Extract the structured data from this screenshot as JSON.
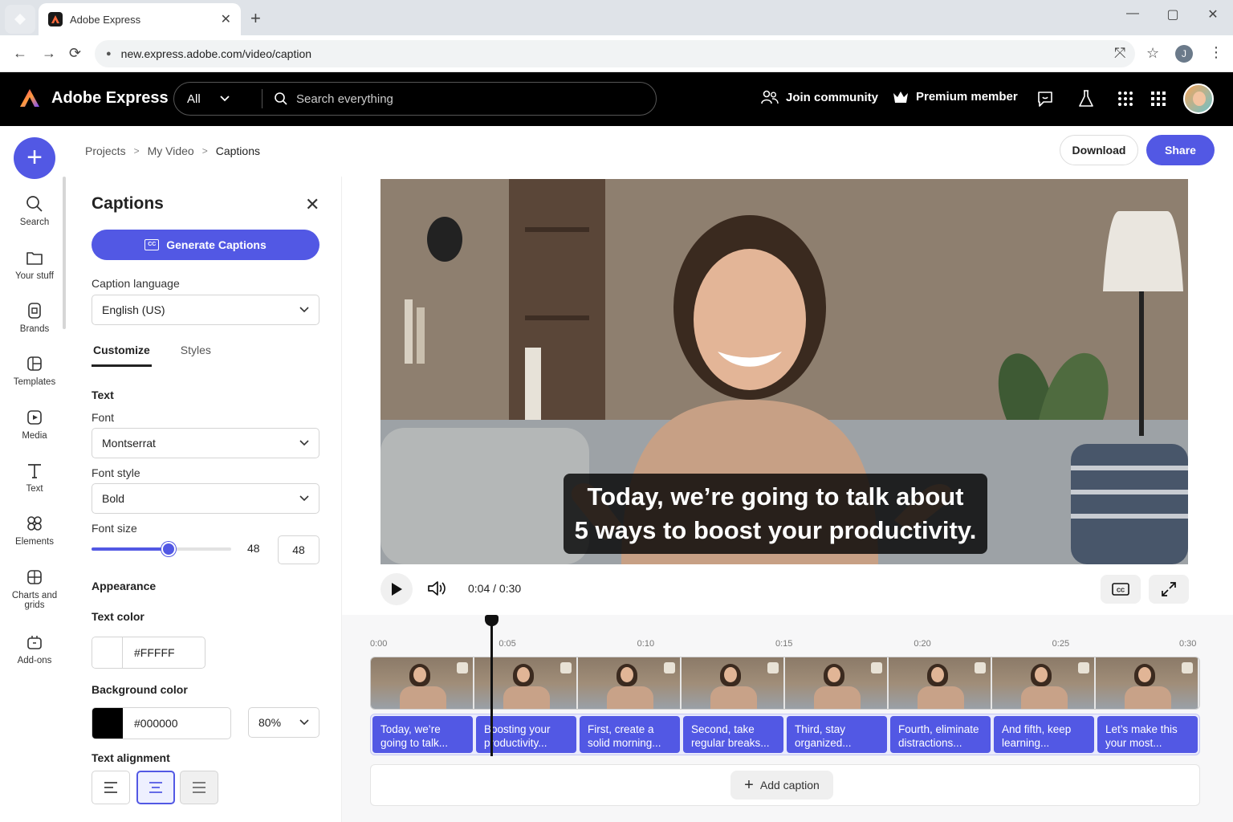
{
  "browser": {
    "tab_title": "Adobe Express",
    "url": "new.express.adobe.com/video/caption",
    "profile_initial": "J"
  },
  "header": {
    "brand": "Adobe Express",
    "search_scope": "All",
    "search_placeholder": "Search everything",
    "join_community": "Join community",
    "premium": "Premium member"
  },
  "rail": {
    "items": [
      {
        "label": "Search",
        "icon": "search-icon"
      },
      {
        "label": "Your stuff",
        "icon": "folder-icon"
      },
      {
        "label": "Brands",
        "icon": "brands-icon"
      },
      {
        "label": "Templates",
        "icon": "templates-icon"
      },
      {
        "label": "Media",
        "icon": "media-icon"
      },
      {
        "label": "Text",
        "icon": "text-icon"
      },
      {
        "label": "Elements",
        "icon": "elements-icon"
      },
      {
        "label": "Charts and grids",
        "icon": "grid-icon"
      },
      {
        "label": "Add-ons",
        "icon": "addons-icon"
      }
    ]
  },
  "breadcrumb": [
    "Projects",
    "My Video",
    "Captions"
  ],
  "actions": {
    "download": "Download",
    "share": "Share"
  },
  "panel": {
    "title": "Captions",
    "generate": "Generate Captions",
    "caption_language_label": "Caption language",
    "caption_language": "English (US)",
    "tabs": [
      "Customize",
      "Styles"
    ],
    "text_section": "Text",
    "font_label": "Font",
    "font": "Montserrat",
    "font_style_label": "Font style",
    "font_style": "Bold",
    "font_size_label": "Font size",
    "font_size": "48",
    "font_size_fraction": 0.55,
    "appearance": "Appearance",
    "text_color_label": "Text color",
    "text_color": "#FFFFF",
    "bg_color_label": "Background color",
    "bg_color": "#000000",
    "bg_opacity": "80%",
    "alignment_label": "Text alignment",
    "alignment_selected": "center"
  },
  "video": {
    "caption_line1": "Today, we’re going to talk about",
    "caption_line2": "5 ways to boost your productivity.",
    "current_time": "0:04",
    "duration": "0:30"
  },
  "timeline": {
    "ticks": [
      "0:00",
      "0:05",
      "0:10",
      "0:15",
      "0:20",
      "0:25",
      "0:30"
    ],
    "playhead_seconds": 4.4,
    "frames": 8,
    "captions": [
      "Today, we’re going to talk...",
      "Boosting your productivity...",
      "First, create a solid morning...",
      "Second, take regular breaks...",
      "Third, stay organized...",
      "Fourth, eliminate distractions...",
      "And fifth, keep learning...",
      "Let’s make this your most..."
    ],
    "add_caption": "Add caption"
  },
  "colors": {
    "accent": "#5258e4",
    "header_bg": "#000000"
  }
}
